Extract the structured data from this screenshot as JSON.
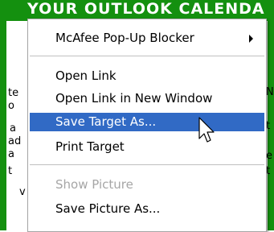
{
  "background": {
    "banner_text": "YOUR OUTLOOK CALENDA",
    "left_fragments": [
      "te",
      "o",
      "a",
      "ad",
      "a",
      "t",
      "v"
    ],
    "right_fragments": [
      "N",
      "t",
      "e",
      "t"
    ]
  },
  "context_menu": {
    "items": [
      {
        "label": "McAfee Pop-Up Blocker",
        "submenu": true
      },
      {
        "label": "Open Link"
      },
      {
        "label": "Open Link in New Window"
      },
      {
        "label": "Save Target As...",
        "selected": true
      },
      {
        "label": "Print Target"
      },
      {
        "label": "Show Picture",
        "disabled": true
      },
      {
        "label": "Save Picture As..."
      }
    ]
  },
  "icons": {
    "submenu_arrow": "triangle-right-icon",
    "cursor": "mouse-pointer-icon"
  },
  "colors": {
    "banner": "#14900f",
    "selection": "#316ac5",
    "disabled_text": "#a6a6a6"
  }
}
